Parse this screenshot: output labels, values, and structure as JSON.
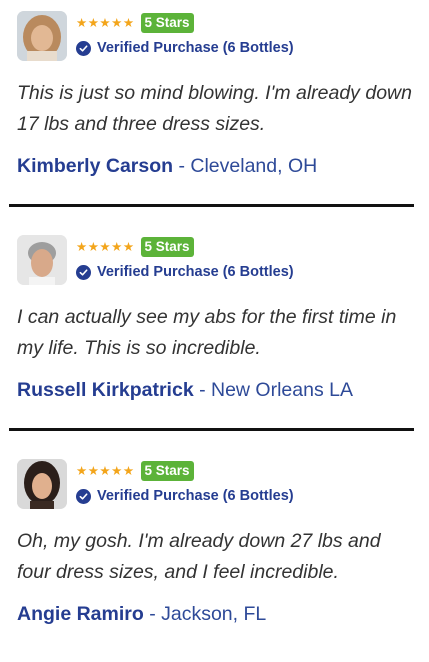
{
  "reviews": [
    {
      "stars": "★★★★★",
      "badge": "5 Stars",
      "verified": "Verified Purchase (6 Bottles)",
      "quote": "This is just so mind blowing. I'm already down 17 lbs and three dress sizes.",
      "name": "Kimberly Carson",
      "location": "- Cleveland, OH"
    },
    {
      "stars": "★★★★★",
      "badge": "5 Stars",
      "verified": "Verified Purchase (6 Bottles)",
      "quote": "I can actually see my abs for the first time in my life. This is so incredible.",
      "name": "Russell Kirkpatrick",
      "location": "- New Orleans LA"
    },
    {
      "stars": "★★★★★",
      "badge": "5 Stars",
      "verified": "Verified Purchase (6 Bottles)",
      "quote": "Oh, my gosh. I'm already down 27 lbs and four dress sizes, and I feel incredible.",
      "name": "Angie Ramiro",
      "location": "- Jackson, FL"
    }
  ],
  "colors": {
    "star": "#f3a51b",
    "badge": "#5cb339",
    "brand_blue": "#253d91",
    "divider": "#111111"
  },
  "icons": [
    "avatar-photo",
    "verified-check-icon"
  ]
}
